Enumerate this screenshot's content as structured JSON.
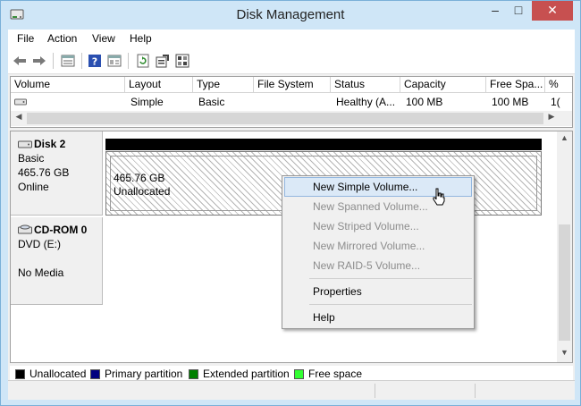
{
  "window": {
    "title": "Disk Management",
    "minimize": "–",
    "maximize": "□",
    "close": "✕"
  },
  "menubar": [
    "File",
    "Action",
    "View",
    "Help"
  ],
  "toolbar": {
    "icons": [
      "back-arrow-icon",
      "forward-arrow-icon",
      "disk-list-icon",
      "help-icon",
      "properties-icon",
      "refresh-icon",
      "settings-icon",
      "export-icon"
    ]
  },
  "volume_list": {
    "columns": [
      "Volume",
      "Layout",
      "Type",
      "File System",
      "Status",
      "Capacity",
      "Free Spa...",
      "%"
    ],
    "rows": [
      {
        "volume": "",
        "layout": "Simple",
        "type": "Basic",
        "file_system": "",
        "status": "Healthy (A...",
        "capacity": "100 MB",
        "free_space": "100 MB",
        "percent": "1("
      }
    ]
  },
  "disks": [
    {
      "name": "Disk 2",
      "type": "Basic",
      "size": "465.76 GB",
      "state": "Online",
      "partition": {
        "size": "465.76 GB",
        "label": "Unallocated"
      }
    },
    {
      "name": "CD-ROM 0",
      "type": "DVD (E:)",
      "size": "",
      "state": "No Media"
    }
  ],
  "context_menu": {
    "items": [
      {
        "label": "New Simple Volume...",
        "enabled": true,
        "highlighted": true
      },
      {
        "label": "New Spanned Volume...",
        "enabled": false
      },
      {
        "label": "New Striped Volume...",
        "enabled": false
      },
      {
        "label": "New Mirrored Volume...",
        "enabled": false
      },
      {
        "label": "New RAID-5 Volume...",
        "enabled": false
      },
      {
        "label": "Properties",
        "enabled": true
      },
      {
        "label": "Help",
        "enabled": true
      }
    ]
  },
  "legend": [
    {
      "label": "Unallocated",
      "color": "#000000"
    },
    {
      "label": "Primary partition",
      "color": "#000080"
    },
    {
      "label": "Extended partition",
      "color": "#008000"
    },
    {
      "label": "Free space",
      "color": "#33ff33"
    }
  ],
  "colors": {
    "title_bar": "#cfe6f7",
    "close_button": "#c75050",
    "menu_highlight": "#dbe9f7"
  }
}
